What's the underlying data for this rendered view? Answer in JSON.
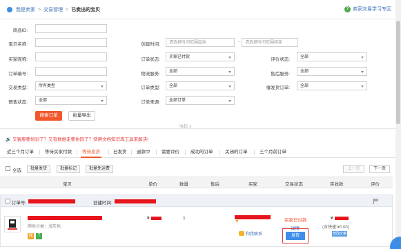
{
  "breadcrumb": {
    "home": "我是卖家",
    "section": "交易管理",
    "current": "已卖出的宝贝"
  },
  "help_link": "卖家交易学习专区",
  "filters": {
    "product_id": {
      "label": "商品ID:",
      "value": ""
    },
    "product_name": {
      "label": "宝贝名称:",
      "value": ""
    },
    "buyer_nick": {
      "label": "买家昵称:",
      "value": ""
    },
    "order_no": {
      "label": "订单编号:",
      "value": ""
    },
    "trade_type": {
      "label": "交易类型:",
      "value": "所有类型"
    },
    "presale_status": {
      "label": "预售状态:",
      "value": "全部"
    },
    "create_time": {
      "label": "创建时间:",
      "start_placeholder": "请选择时间范围起始",
      "end_placeholder": "请选择时间范围结束",
      "separator": "-"
    },
    "order_status": {
      "label": "订单状态:",
      "value": "买家已付款"
    },
    "logistics": {
      "label": "物流服务:",
      "value": "全部"
    },
    "after_sale": {
      "label": "售后服务:",
      "value": "全部"
    },
    "order_type": {
      "label": "订单类型:",
      "value": "全部"
    },
    "order_source": {
      "label": "订单来源:",
      "value": "全部订单"
    },
    "rating_status": {
      "label": "评价状态:",
      "value": "全部"
    },
    "urge_ship": {
      "label": "催发货订单:",
      "value": "全部"
    }
  },
  "buttons": {
    "search": "搜索订单",
    "export": "批量导出",
    "collapse": "收起 ∧"
  },
  "notice": {
    "icon": "🔊",
    "text": "又客服要培训了？又有数据走要协同了？快用文档知识库工具来解决!"
  },
  "tabs": [
    "近三个月订单",
    "等待买家付款",
    "等待发货",
    "已发货",
    "退款中",
    "需要评价",
    "成功的订单",
    "关闭的订单",
    "三个月前订单"
  ],
  "active_tab": "等待发货",
  "actions": {
    "select_all": "全选",
    "batch_ship": "批量发货",
    "batch_mark": "批量标记",
    "batch_free_shipping": "批量免运费",
    "prev": "上一页",
    "next": "下一页"
  },
  "columns": [
    "宝贝",
    "单价",
    "数量",
    "售后",
    "买家",
    "交易状态",
    "实收款",
    "评价"
  ],
  "order": {
    "order_no_label": "订单号:",
    "create_time_label": "创建时间:",
    "item_attr": "颜色分类：浅灰色",
    "tag_yellow": "保",
    "tag_green": "7",
    "price_prefix": "¥",
    "quantity": "1",
    "contact_label": "和我联系",
    "status": "买家已付款",
    "detail": "详情",
    "ship_button": "发货",
    "amount_prefix": "¥",
    "postage": "(含快递:¥0.00)",
    "change_price": "修改价格"
  },
  "colors": {
    "accent": "#f2572c",
    "link": "#3a6fb6",
    "redact": "#e8141c",
    "ship": "#3d8ee8"
  }
}
